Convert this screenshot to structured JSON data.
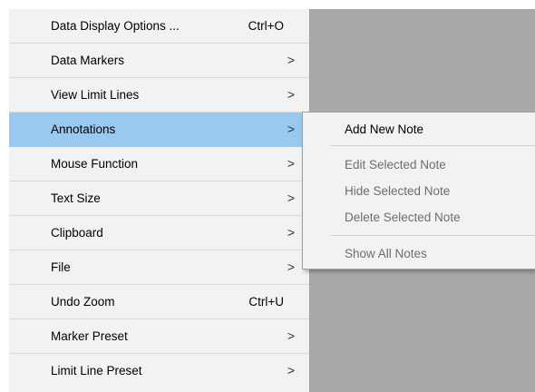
{
  "menu": {
    "items": [
      {
        "label": "Data Display Options ...",
        "shortcut": "Ctrl+O",
        "submenu": false
      },
      {
        "label": "Data Markers",
        "shortcut": "",
        "submenu": true
      },
      {
        "label": "View Limit Lines",
        "shortcut": "",
        "submenu": true
      },
      {
        "label": "Annotations",
        "shortcut": "",
        "submenu": true,
        "highlighted": true
      },
      {
        "label": "Mouse Function",
        "shortcut": "",
        "submenu": true
      },
      {
        "label": "Text Size",
        "shortcut": "",
        "submenu": true
      },
      {
        "label": "Clipboard",
        "shortcut": "",
        "submenu": true
      },
      {
        "label": "File",
        "shortcut": "",
        "submenu": true
      },
      {
        "label": "Undo Zoom",
        "shortcut": "Ctrl+U",
        "submenu": false
      },
      {
        "label": "Marker Preset",
        "shortcut": "",
        "submenu": true
      },
      {
        "label": "Limit Line Preset",
        "shortcut": "",
        "submenu": true
      }
    ],
    "chevron": ">"
  },
  "submenu": {
    "items": [
      {
        "label": "Add New Note",
        "enabled": true
      },
      {
        "label": "Edit Selected Note",
        "enabled": false
      },
      {
        "label": "Hide Selected Note",
        "enabled": false
      },
      {
        "label": "Delete Selected  Note",
        "enabled": false
      },
      {
        "label": "Show All Notes",
        "enabled": false
      }
    ]
  },
  "colors": {
    "highlight": "#99c9ef",
    "menu_bg": "#f2f2f2",
    "app_bg": "#a9a9a9",
    "disabled_text": "#6d6d6d"
  }
}
